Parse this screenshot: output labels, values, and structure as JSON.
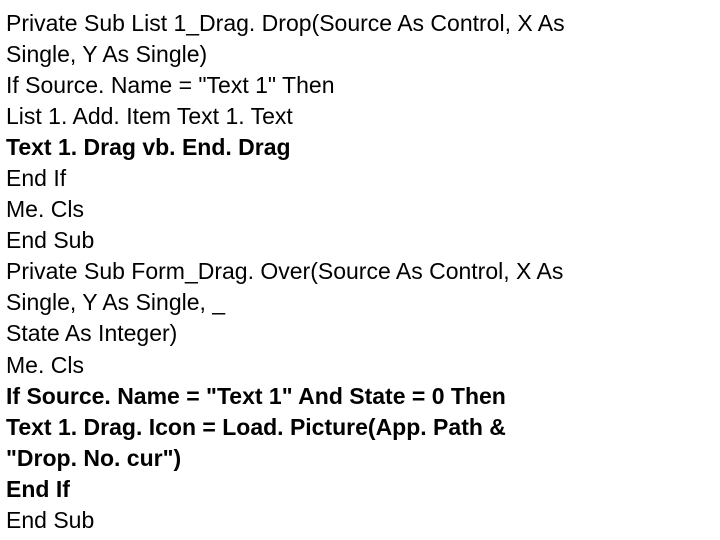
{
  "lines": [
    {
      "text": "Private Sub List 1_Drag. Drop(Source As Control, X As",
      "bold": false
    },
    {
      "text": "Single, Y As Single)",
      "bold": false
    },
    {
      "text": "If Source. Name = \"Text 1\" Then",
      "bold": false
    },
    {
      "text": "List 1. Add. Item Text 1. Text",
      "bold": false
    },
    {
      "text": "Text 1. Drag vb. End. Drag",
      "bold": true
    },
    {
      "text": "End If",
      "bold": false
    },
    {
      "text": "Me. Cls",
      "bold": false
    },
    {
      "text": "End Sub",
      "bold": false
    },
    {
      "text": "Private Sub Form_Drag. Over(Source As Control, X As",
      "bold": false
    },
    {
      "text": "Single, Y As Single, _",
      "bold": false
    },
    {
      "text": "State As Integer)",
      "bold": false
    },
    {
      "text": "Me. Cls",
      "bold": false
    },
    {
      "text": "If Source. Name = \"Text 1\" And State = 0 Then",
      "bold": true
    },
    {
      "text": "Text 1. Drag. Icon = Load. Picture(App. Path &",
      "bold": true
    },
    {
      "text": "\"Drop. No. cur\")",
      "bold": true
    },
    {
      "text": "End If",
      "bold": true
    },
    {
      "text": "End Sub",
      "bold": false
    }
  ]
}
